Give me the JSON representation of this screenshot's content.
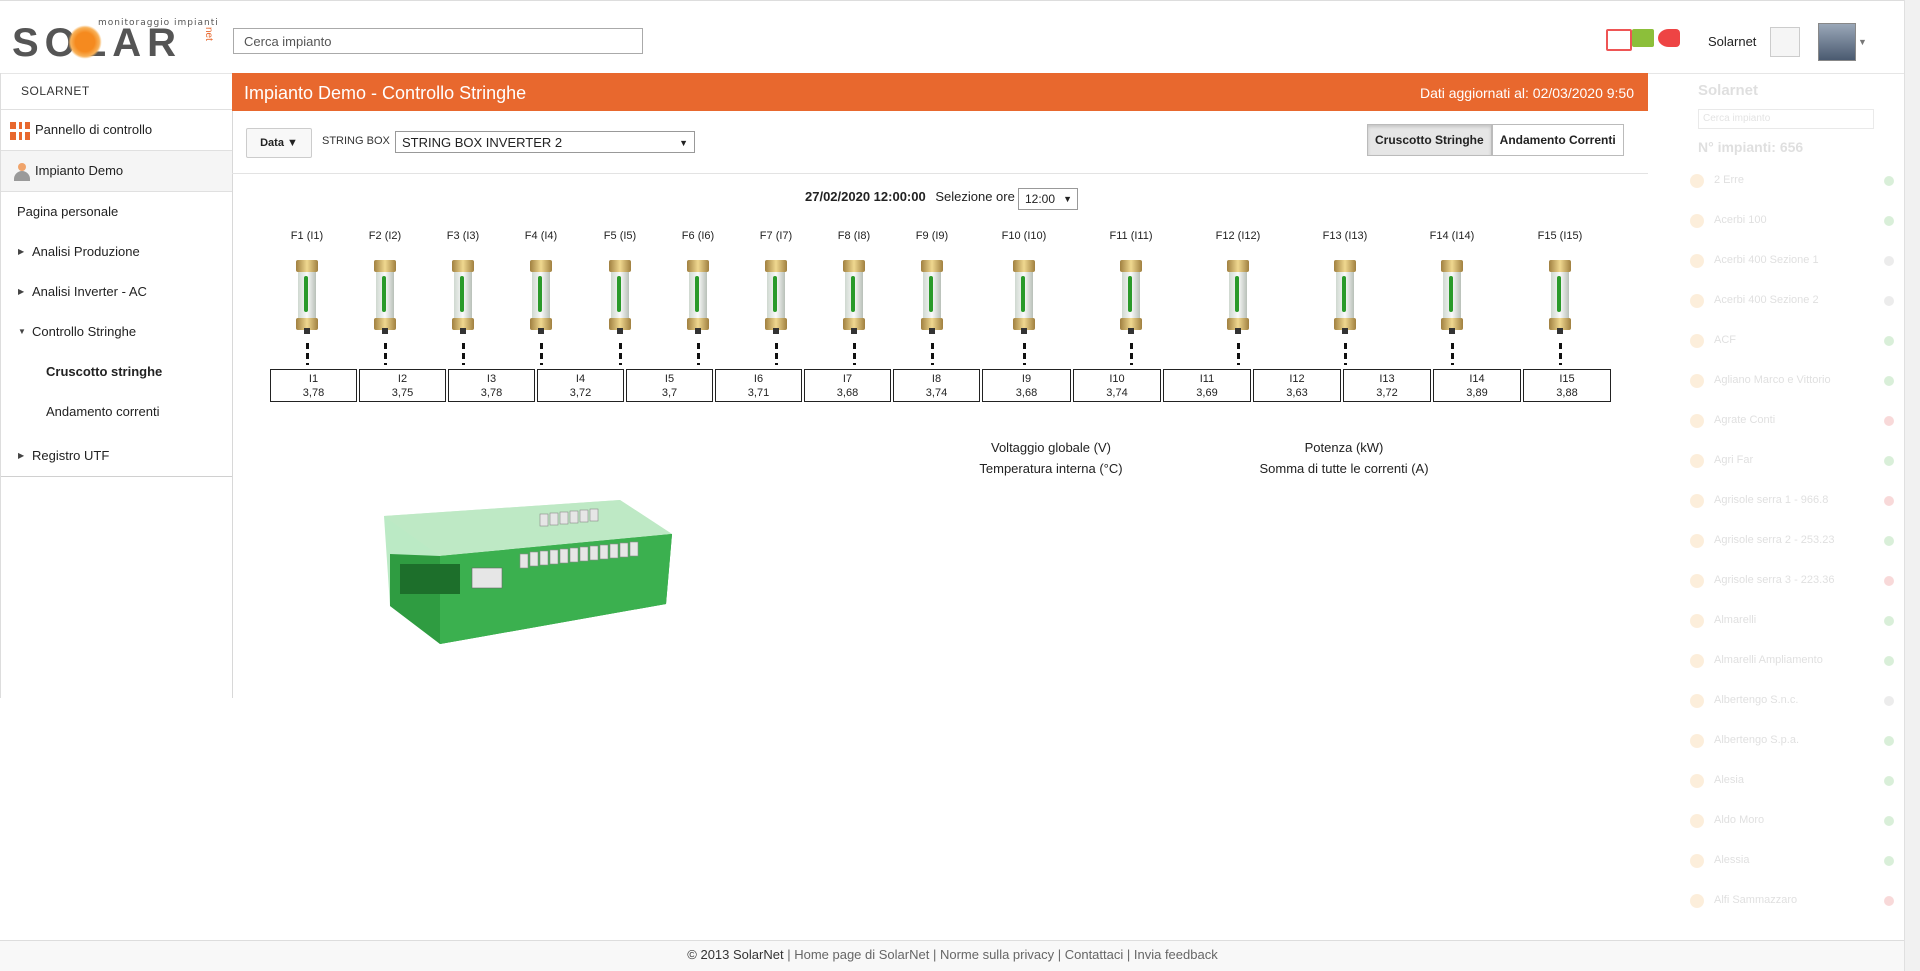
{
  "header": {
    "logo_tagline": "monitoraggio impianti",
    "logo_word": "SOLAR",
    "logo_suffix": "net",
    "search_placeholder": "Cerca impianto",
    "username": "Solarnet",
    "icons": [
      "solar-panel-icon",
      "chart-icon",
      "engine-icon"
    ],
    "accent": "#e8682e"
  },
  "sidebar": {
    "title": "SOLARNET",
    "items": [
      {
        "label": "Pannello di controllo"
      },
      {
        "label": "Impianto Demo"
      },
      {
        "label": "Pagina personale"
      },
      {
        "label": "Analisi Produzione"
      },
      {
        "label": "Analisi Inverter - AC"
      },
      {
        "label": "Controllo Stringhe"
      },
      {
        "label": "Cruscotto stringhe"
      },
      {
        "label": "Andamento correnti"
      },
      {
        "label": "Registro UTF"
      }
    ]
  },
  "main": {
    "title": "Impianto Demo - Controllo Stringhe",
    "updated": "Dati aggiornati al: 02/03/2020 9:50",
    "data_button": "Data ▼",
    "string_box_label": "STRING BOX",
    "string_box_value": "STRING BOX INVERTER 2",
    "tabs": [
      "Cruscotto Stringhe",
      "Andamento Correnti"
    ],
    "datetime": "27/02/2020 12:00:00",
    "hour_label": "Selezione ore",
    "hour_value": "12:00",
    "fuses": [
      "F1 (I1)",
      "F2 (I2)",
      "F3 (I3)",
      "F4 (I4)",
      "F5 (I5)",
      "F6 (I6)",
      "F7 (I7)",
      "F8 (I8)",
      "F9 (I9)",
      "F10 (I10)",
      "F11 (I11)",
      "F12 (I12)",
      "F13 (I13)",
      "F14 (I14)",
      "F15 (I15)"
    ],
    "currents": [
      {
        "label": "I1",
        "value": "3,78"
      },
      {
        "label": "I2",
        "value": "3,75"
      },
      {
        "label": "I3",
        "value": "3,78"
      },
      {
        "label": "I4",
        "value": "3,72"
      },
      {
        "label": "I5",
        "value": "3,7"
      },
      {
        "label": "I6",
        "value": "3,71"
      },
      {
        "label": "I7",
        "value": "3,68"
      },
      {
        "label": "I8",
        "value": "3,74"
      },
      {
        "label": "I9",
        "value": "3,68"
      },
      {
        "label": "I10",
        "value": "3,74"
      },
      {
        "label": "I11",
        "value": "3,69"
      },
      {
        "label": "I12",
        "value": "3,63"
      },
      {
        "label": "I13",
        "value": "3,72"
      },
      {
        "label": "I14",
        "value": "3,89"
      },
      {
        "label": "I15",
        "value": "3,88"
      }
    ],
    "stats": {
      "voltage": "Voltaggio globale (V)",
      "temperature": "Temperatura interna (°C)",
      "power": "Potenza (kW)",
      "current_sum": "Somma di tutte le correnti (A)"
    }
  },
  "right_panel": {
    "title": "Solarnet",
    "search_placeholder": "Cerca impianto",
    "count": "N° impianti: 656",
    "items": [
      {
        "name": "2 Erre",
        "status": "#3a3"
      },
      {
        "name": "Acerbi 100",
        "status": "#3a3"
      },
      {
        "name": "Acerbi 400 Sezione 1",
        "status": "#999"
      },
      {
        "name": "Acerbi 400 Sezione 2",
        "status": "#999"
      },
      {
        "name": "ACF",
        "status": "#3a3"
      },
      {
        "name": "Agliano Marco e Vittorio",
        "status": "#3a3"
      },
      {
        "name": "Agrate Conti",
        "status": "#d33"
      },
      {
        "name": "Agri Far",
        "status": "#3a3"
      },
      {
        "name": "Agrisole serra 1 - 966.8",
        "status": "#d33"
      },
      {
        "name": "Agrisole serra 2 - 253.23",
        "status": "#3a3"
      },
      {
        "name": "Agrisole serra 3 - 223.36",
        "status": "#d33"
      },
      {
        "name": "Almarelli",
        "status": "#3a3"
      },
      {
        "name": "Almarelli Ampliamento",
        "status": "#3a3"
      },
      {
        "name": "Albertengo S.n.c.",
        "status": "#999"
      },
      {
        "name": "Albertengo S.p.a.",
        "status": "#3a3"
      },
      {
        "name": "Alesia",
        "status": "#3a3"
      },
      {
        "name": "Aldo Moro",
        "status": "#3a3"
      },
      {
        "name": "Alessia",
        "status": "#3a3"
      },
      {
        "name": "Alfi Sammazzaro",
        "status": "#d33"
      }
    ]
  },
  "footer": {
    "copyright": "© 2013 SolarNet",
    "links": [
      "Home page di SolarNet",
      "Norme sulla privacy",
      "Contattaci",
      "Invia feedback"
    ]
  }
}
